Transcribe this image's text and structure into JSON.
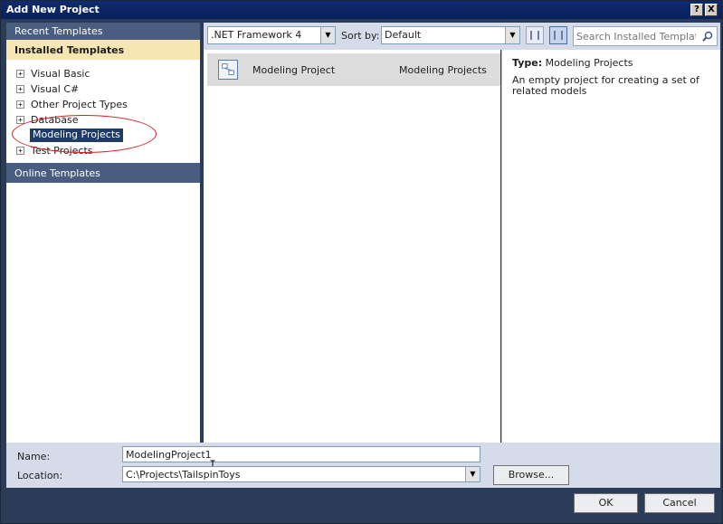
{
  "window": {
    "title": "Add New Project",
    "help_label": "?",
    "close_label": "X"
  },
  "sidebar": {
    "recent_label": "Recent Templates",
    "installed_label": "Installed Templates",
    "online_label": "Online Templates",
    "items": [
      {
        "label": "Visual Basic",
        "expander": "+"
      },
      {
        "label": "Visual C#",
        "expander": "+"
      },
      {
        "label": "Other Project Types",
        "expander": "+"
      },
      {
        "label": "Database",
        "expander": "+"
      },
      {
        "label": "Modeling Projects",
        "expander": ""
      },
      {
        "label": "Test Projects",
        "expander": "+"
      }
    ],
    "selected_item": "Modeling Projects"
  },
  "toolbar": {
    "framework_value": ".NET Framework 4",
    "sort_label": "Sort by:",
    "sort_value": "Default",
    "search_placeholder": "Search Installed Templates"
  },
  "templates": [
    {
      "name": "Modeling Project",
      "type": "Modeling Projects"
    }
  ],
  "description": {
    "type_key": "Type:",
    "type_value": "Modeling Projects",
    "text": "An empty project for creating a set of related models"
  },
  "form": {
    "name_label": "Name:",
    "name_value": "ModelingProject1",
    "location_label": "Location:",
    "location_value": "C:\\Projects\\TailspinToys",
    "browse_label": "Browse..."
  },
  "footer": {
    "ok_label": "OK",
    "cancel_label": "Cancel"
  },
  "colors": {
    "selection": "#1f3b69",
    "installed_header": "#f6e6b4",
    "annotation": "#d32020"
  },
  "icons": {
    "template_icon": "modeling-project-icon",
    "search": "search-icon",
    "dropdown": "chevron-down-icon"
  }
}
